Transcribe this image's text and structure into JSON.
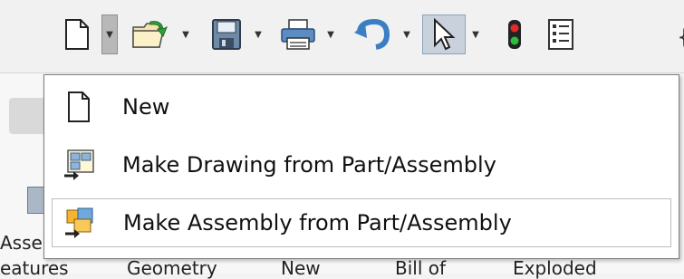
{
  "toolbar": {
    "items": [
      {
        "name": "new-document-icon"
      },
      {
        "name": "open-folder-icon"
      },
      {
        "name": "save-floppy-icon"
      },
      {
        "name": "print-icon"
      },
      {
        "name": "undo-icon"
      },
      {
        "name": "select-pointer-icon"
      },
      {
        "name": "rebuild-traffic-light-icon"
      },
      {
        "name": "file-properties-icon"
      }
    ],
    "cut_text": "{"
  },
  "ribbon": {
    "left_text": "Asse",
    "bottom_texts": [
      "eatures",
      "Geometry",
      "New",
      "Bill of",
      "Exploded"
    ]
  },
  "menu": {
    "items": [
      {
        "label": "New"
      },
      {
        "label": "Make Drawing from Part/Assembly"
      },
      {
        "label": "Make Assembly from Part/Assembly"
      }
    ]
  }
}
